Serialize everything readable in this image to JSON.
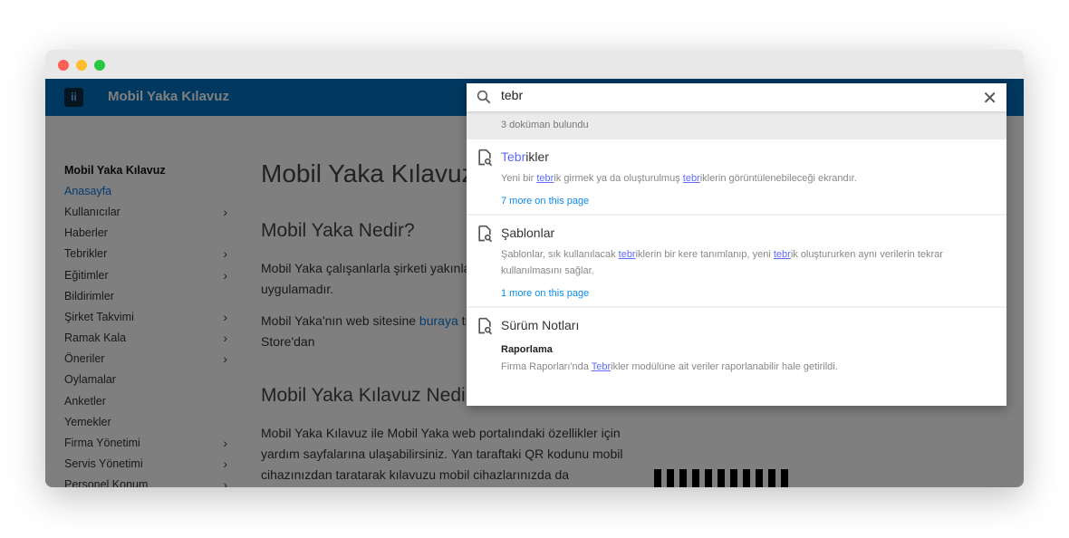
{
  "window": {
    "colors": {
      "close": "#fe5f57",
      "minimize": "#febc2e",
      "maximize": "#28c840"
    }
  },
  "header": {
    "title": "Mobil Yaka Kılavuz",
    "logo_icon": "app-logo-icon"
  },
  "sidebar": {
    "items": [
      {
        "label": "Mobil Yaka Kılavuz",
        "type": "head"
      },
      {
        "label": "Anasayfa",
        "type": "active"
      },
      {
        "label": "Kullanıcılar",
        "chevron": true
      },
      {
        "label": "Haberler"
      },
      {
        "label": "Tebrikler",
        "chevron": true
      },
      {
        "label": "Eğitimler",
        "chevron": true
      },
      {
        "label": "Bildirimler"
      },
      {
        "label": "Şirket Takvimi",
        "chevron": true
      },
      {
        "label": "Ramak Kala",
        "chevron": true
      },
      {
        "label": "Öneriler",
        "chevron": true
      },
      {
        "label": "Oylamalar"
      },
      {
        "label": "Anketler"
      },
      {
        "label": "Yemekler"
      },
      {
        "label": "Firma Yönetimi",
        "chevron": true
      },
      {
        "label": "Servis Yönetimi",
        "chevron": true
      },
      {
        "label": "Personel Konum",
        "chevron": true
      }
    ]
  },
  "main": {
    "h1": "Mobil Yaka Kılavuz'",
    "h2a": "Mobil Yaka Nedir?",
    "p1": "Mobil Yaka çalışanlarla şirketi yakınla sağlayan bir mobil uygulamadır.",
    "p2a": "Mobil Yaka'nın web sitesine ",
    "p2link": "buraya",
    "p2b": " tı ve Android için Google Play Store'dan",
    "h2b": "Mobil Yaka Kılavuz Nedir",
    "p3": "Mobil Yaka Kılavuz ile Mobil Yaka web portalındaki özellikler için yardım sayfalarına ulaşabilirsiniz. Yan taraftaki QR kodunu mobil cihazınızdan taratarak kılavuzu mobil cihazlarınızda da"
  },
  "search": {
    "query": "tebr",
    "count": "3 doküman bulundu",
    "results": [
      {
        "title_hl": "Tebr",
        "title_rest": "ikler",
        "desc": [
          "Yeni bir ",
          "tebr",
          "ik girmek ya da oluşturulmuş ",
          "tebr",
          "iklerin görüntülenebileceği ekrandır."
        ],
        "more": "7 more on this page"
      },
      {
        "title": "Şablonlar",
        "desc": [
          "Şablonlar, sık kullanılacak ",
          "tebr",
          "iklerin bir kere tanımlanıp, yeni ",
          "tebr",
          "ik oluştururken aynı verilerin tekrar kullanılmasını sağlar."
        ],
        "more": "1 more on this page"
      },
      {
        "title": "Sürüm Notları",
        "sub": "Raporlama",
        "desc": [
          "Firma Raporları'nda ",
          "Tebr",
          "ikler modülüne ait veriler raporlanabilir hale getirildi."
        ]
      }
    ]
  }
}
